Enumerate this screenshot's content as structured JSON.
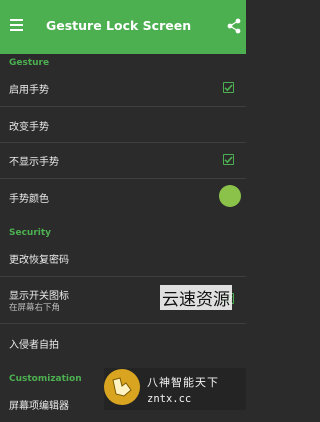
{
  "toolbar": {
    "title": "Gesture Lock Screen",
    "menu_icon": "hamburger-menu-icon",
    "share_icon": "share-icon",
    "color": "#4caf50"
  },
  "sections": {
    "gesture": "Gesture",
    "security": "Security",
    "customization": "Customization"
  },
  "prefs": {
    "enable_gesture": {
      "title": "启用手势",
      "checked": true
    },
    "change_gesture": {
      "title": "改变手势"
    },
    "hide_gesture": {
      "title": "不显示手势",
      "checked": true
    },
    "gesture_color": {
      "title": "手势颜色",
      "color": "#8bc34a"
    },
    "change_recovery_password": {
      "title": "更改恢复密码"
    },
    "show_switch_icon": {
      "title": "显示开关图标",
      "summary": "在屏幕右下角",
      "checked": true
    },
    "intruder_selfie": {
      "title": "入侵者自拍"
    },
    "screen_item_editor": {
      "title": "屏幕项编辑器"
    }
  },
  "watermarks": {
    "top": "云速资源",
    "logo_line1": "八神智能天下",
    "logo_line2": "zntx.cc"
  }
}
